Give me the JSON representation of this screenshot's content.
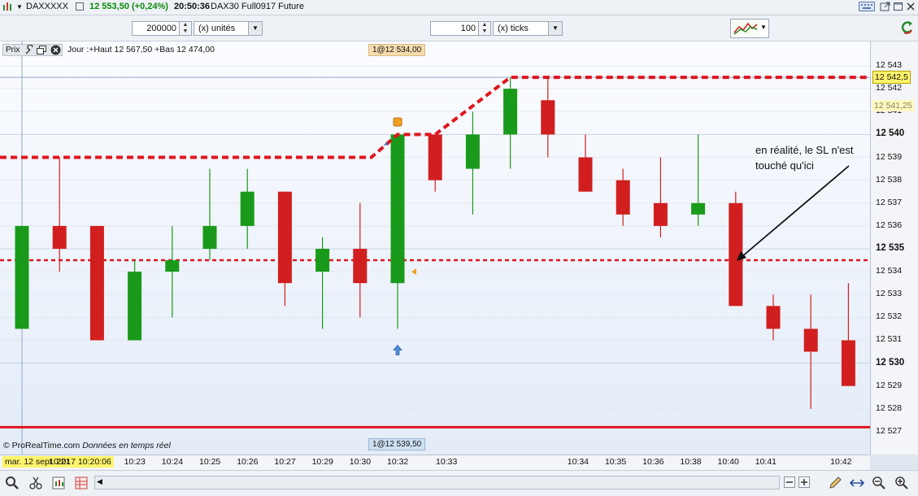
{
  "header": {
    "instrument": "DAXXXXX",
    "last_price_change": "12 553,50 (+0,24%)",
    "time": "20:50:36",
    "description": "DAX30 Full0917 Future"
  },
  "toolbar": {
    "quantity_value": "200000",
    "quantity_unit": "(x) unités",
    "ticks_value": "100",
    "ticks_unit": "(x) ticks"
  },
  "chart_header": {
    "prix_label": "Prix",
    "info": "Jour :+Haut 12 567,50 +Bas 12 474,00"
  },
  "order_tags": {
    "top": "1@12 534,00",
    "bottom": "1@12 539,50"
  },
  "annotation": {
    "line1": "en réalité, le SL n'est",
    "line2": "touché qu'ici"
  },
  "watermark": {
    "brand": "© ProRealTime.com",
    "realtime": "Données en temps réel"
  },
  "price_axis": {
    "labels": [
      "12 543",
      "12 542",
      "12 541",
      "12 540",
      "12 539",
      "12 538",
      "12 537",
      "12 536",
      "12 535",
      "12 534",
      "12 533",
      "12 532",
      "12 531",
      "12 530",
      "12 529",
      "12 528",
      "12 527"
    ],
    "bold_labels": [
      "12 540",
      "12 535",
      "12 530"
    ],
    "highlight_current": "12 542,5",
    "highlight_secondary": "12 541,25"
  },
  "time_axis": {
    "date_label": "mar. 12 sept. 2017 10:20:06",
    "labels": [
      "10:21",
      "10:23",
      "10:24",
      "10:25",
      "10:26",
      "10:27",
      "10:29",
      "10:30",
      "10:32",
      "10:33",
      "10:34",
      "10:35",
      "10:36",
      "10:38",
      "10:40",
      "10:41",
      "10:42"
    ]
  },
  "colors": {
    "bull": "#1a9a1a",
    "bear": "#d11f1f",
    "stop_line": "#e0141e",
    "current_tag_bg": "#fff46b"
  },
  "chart_data": {
    "type": "candlestick",
    "ylim": [
      12526.5,
      12543.5
    ],
    "candles": [
      {
        "o": 12531.5,
        "h": 12536,
        "l": 12531.5,
        "c": 12536
      },
      {
        "o": 12536,
        "h": 12539,
        "l": 12534,
        "c": 12535
      },
      {
        "o": 12536,
        "h": 12536,
        "l": 12531,
        "c": 12531
      },
      {
        "o": 12531,
        "h": 12534.5,
        "l": 12531,
        "c": 12534
      },
      {
        "o": 12534,
        "h": 12536,
        "l": 12532,
        "c": 12534.5
      },
      {
        "o": 12535,
        "h": 12538.5,
        "l": 12534.5,
        "c": 12536
      },
      {
        "o": 12536,
        "h": 12538.5,
        "l": 12535,
        "c": 12537.5
      },
      {
        "o": 12537.5,
        "h": 12537.5,
        "l": 12532.5,
        "c": 12533.5
      },
      {
        "o": 12534,
        "h": 12535.5,
        "l": 12531.5,
        "c": 12535
      },
      {
        "o": 12535,
        "h": 12537,
        "l": 12532,
        "c": 12533.5
      },
      {
        "o": 12533.5,
        "h": 12540,
        "l": 12531.5,
        "c": 12540
      },
      {
        "o": 12540,
        "h": 12540,
        "l": 12537.5,
        "c": 12538
      },
      {
        "o": 12538.5,
        "h": 12541,
        "l": 12536.5,
        "c": 12540
      },
      {
        "o": 12540,
        "h": 12542.5,
        "l": 12538.5,
        "c": 12542
      },
      {
        "o": 12541.5,
        "h": 12542.5,
        "l": 12539,
        "c": 12540
      },
      {
        "o": 12539,
        "h": 12540,
        "l": 12537.5,
        "c": 12537.5
      },
      {
        "o": 12538,
        "h": 12538.5,
        "l": 12536,
        "c": 12536.5
      },
      {
        "o": 12537,
        "h": 12539,
        "l": 12535.5,
        "c": 12536
      },
      {
        "o": 12536.5,
        "h": 12540,
        "l": 12536,
        "c": 12537
      },
      {
        "o": 12537,
        "h": 12537.5,
        "l": 12532.5,
        "c": 12532.5
      },
      {
        "o": 12532.5,
        "h": 12533,
        "l": 12531,
        "c": 12531.5
      },
      {
        "o": 12531.5,
        "h": 12533,
        "l": 12528,
        "c": 12530.5
      },
      {
        "o": 12531,
        "h": 12533.5,
        "l": 12529,
        "c": 12529
      }
    ],
    "trailing_stop": [
      {
        "x": 0,
        "y": 12539
      },
      {
        "x": 9.3,
        "y": 12539
      },
      {
        "x": 10,
        "y": 12540
      },
      {
        "x": 11,
        "y": 12540
      },
      {
        "x": 13,
        "y": 12542.5
      },
      {
        "x": 22.5,
        "y": 12542.5
      }
    ],
    "stop_level": 12534.5,
    "support_level": 12527.2
  }
}
